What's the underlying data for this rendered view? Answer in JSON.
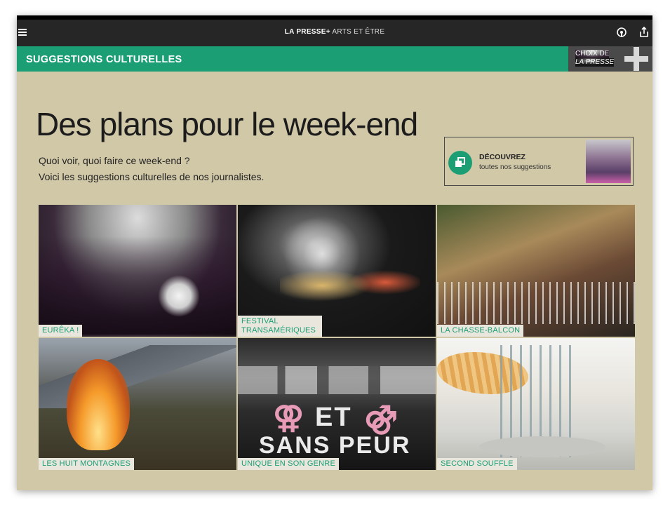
{
  "topbar": {
    "brand_main": "LA PRESSE+",
    "brand_section": " ARTS ET ÊTRE"
  },
  "section_bar": {
    "title": "SUGGESTIONS CULTURELLES",
    "choix_line1": "CHOIX DE",
    "choix_line2": "LA PRESSE"
  },
  "main": {
    "headline": "Des plans pour le week-end",
    "subtitle_line1": "Quoi voir, quoi faire ce week-end ?",
    "subtitle_line2": "Voici les suggestions culturelles de nos journalistes."
  },
  "discover": {
    "title": "DÉCOUVREZ",
    "subtitle": "toutes nos suggestions"
  },
  "tiles": [
    {
      "label": "EURÊKA !"
    },
    {
      "label": "FESTIVAL TRANSAMÉRIQUES"
    },
    {
      "label": "LA CHASSE-BALCON"
    },
    {
      "label": "LES HUIT MONTAGNES"
    },
    {
      "label": "UNIQUE EN SON GENRE"
    },
    {
      "label": "SECOND SOUFFLE"
    }
  ],
  "tile5_sign": {
    "line1": "ET",
    "line2": "SANS PEUR"
  },
  "colors": {
    "accent_green": "#1b9e73",
    "background_beige": "#d1c8a8",
    "topbar": "#262626"
  },
  "icons": [
    "menu-icon",
    "podcast-icon",
    "share-icon",
    "plus-icon",
    "copy-icon"
  ]
}
